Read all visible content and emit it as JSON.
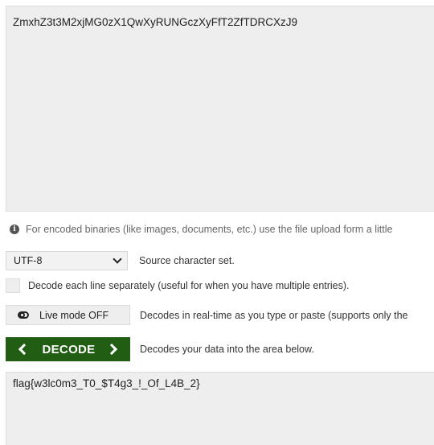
{
  "input": {
    "value": "ZmxhZ3t3M2xjMG0zX1QwXyRUNGczXyFfT2ZfTDRCXzJ9"
  },
  "hint": {
    "text": "For encoded binaries (like images, documents, etc.) use the file upload form a little"
  },
  "charset": {
    "selected": "UTF-8",
    "description": "Source character set."
  },
  "each_line": {
    "checked": false,
    "label": "Decode each line separately (useful for when you have multiple entries)."
  },
  "live_mode": {
    "label": "Live mode OFF",
    "description": "Decodes in real-time as you type or paste (supports only the"
  },
  "decode": {
    "label": "DECODE",
    "description": "Decodes your data into the area below.",
    "color": "#215e14"
  },
  "output": {
    "value": "flag{w3lc0m3_T0_$T4g3_!_Of_L4B_2}"
  }
}
